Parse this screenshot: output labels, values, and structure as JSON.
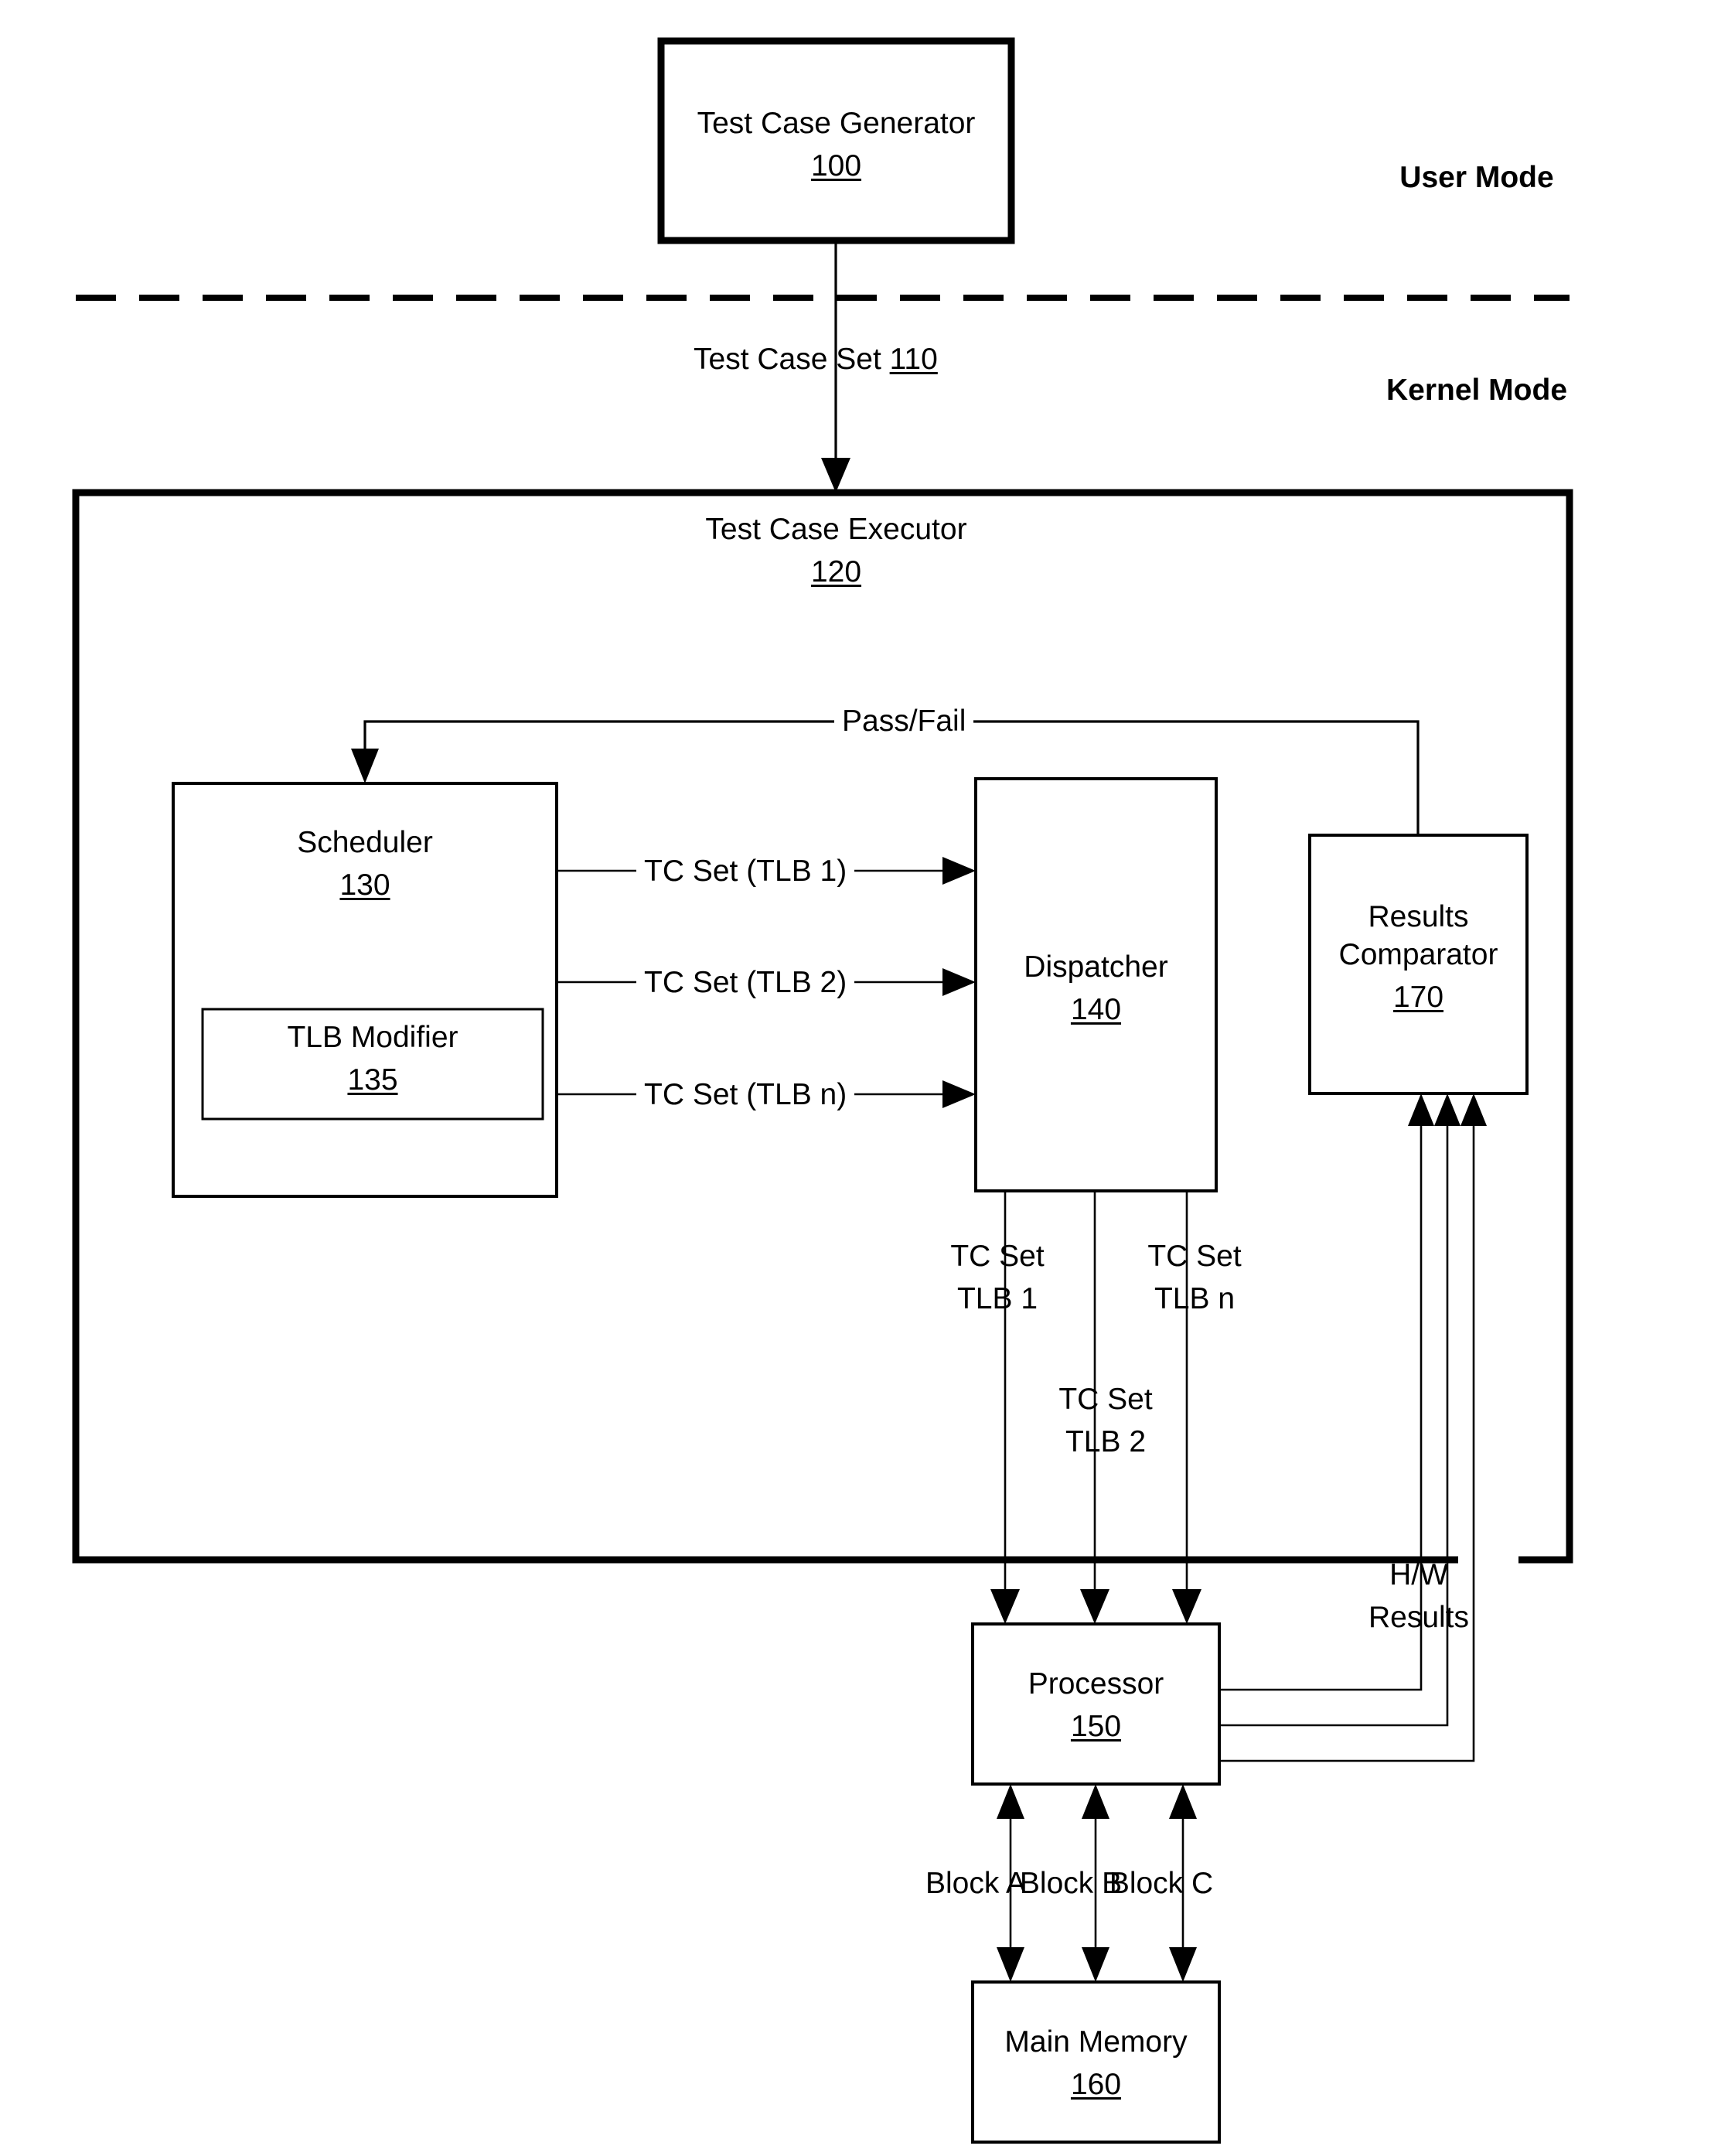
{
  "figure": {
    "modes": {
      "user_mode": "User Mode",
      "kernel_mode": "Kernel Mode"
    },
    "blocks": {
      "test_case_generator": {
        "title": "Test Case Generator",
        "ref": "100"
      },
      "test_case_executor": {
        "title": "Test Case Executor",
        "ref": "120"
      },
      "scheduler": {
        "title": "Scheduler",
        "ref": "130"
      },
      "tlb_modifier": {
        "title": "TLB Modifier",
        "ref": "135"
      },
      "dispatcher": {
        "title": "Dispatcher",
        "ref": "140"
      },
      "results_comparator": {
        "title_line1": "Results",
        "title_line2": "Comparator",
        "ref": "170"
      },
      "processor": {
        "title": "Processor",
        "ref": "150"
      },
      "main_memory": {
        "title": "Main Memory",
        "ref": "160"
      }
    },
    "edge_labels": {
      "test_case_set": {
        "text": "Test Case Set ",
        "ref": "110"
      },
      "pass_fail": "Pass/Fail",
      "tc_set_tlb_1": "TC Set (TLB 1)",
      "tc_set_tlb_2": "TC Set (TLB 2)",
      "tc_set_tlb_n": "TC Set (TLB n)",
      "tc_set_tlb_1_down_l1": "TC Set",
      "tc_set_tlb_1_down_l2": "TLB 1",
      "tc_set_tlb_2_down_l1": "TC Set",
      "tc_set_tlb_2_down_l2": "TLB 2",
      "tc_set_tlb_n_down_l1": "TC Set",
      "tc_set_tlb_n_down_l2": "TLB n",
      "hw_results_l1": "H/W",
      "hw_results_l2": "Results",
      "block_a": "Block A",
      "block_b": "Block B",
      "block_c": "Block C"
    },
    "colors": {
      "stroke": "#000000",
      "background": "#ffffff"
    }
  }
}
